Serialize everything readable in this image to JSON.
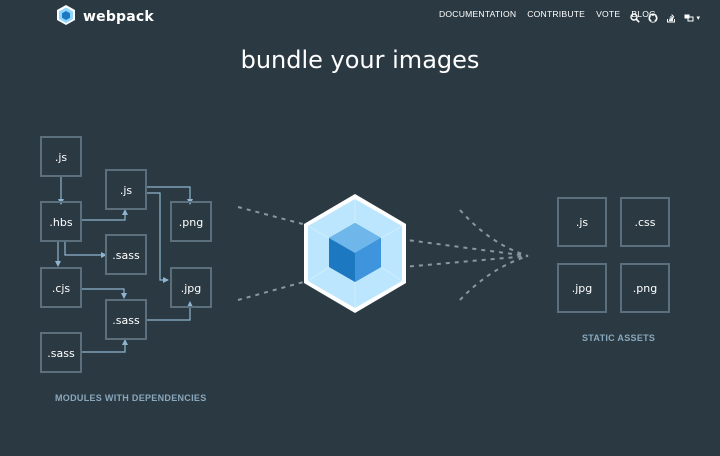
{
  "brand": {
    "name": "webpack"
  },
  "nav": {
    "items": [
      {
        "label": "DOCUMENTATION"
      },
      {
        "label": "CONTRIBUTE"
      },
      {
        "label": "VOTE"
      },
      {
        "label": "BLOG"
      }
    ],
    "icons": [
      "search-icon",
      "github-icon",
      "stack-overflow-icon",
      "language-icon"
    ],
    "language_caret": "▾"
  },
  "headline": "bundle your images",
  "modules": {
    "caption": "MODULES WITH DEPENDENCIES",
    "boxes": [
      ".js",
      ".js",
      ".hbs",
      ".png",
      ".sass",
      ".cjs",
      ".jpg",
      ".sass",
      ".sass"
    ]
  },
  "assets": {
    "caption": "STATIC ASSETS",
    "boxes": [
      ".js",
      ".css",
      ".jpg",
      ".png"
    ]
  },
  "colors": {
    "background": "#2b3a42",
    "box_border": "#5b6f7c",
    "connector": "#8fb4cf",
    "cube_light": "#8ed6fb",
    "cube_dark": "#1c78c0",
    "caption": "#8aa8bd"
  }
}
